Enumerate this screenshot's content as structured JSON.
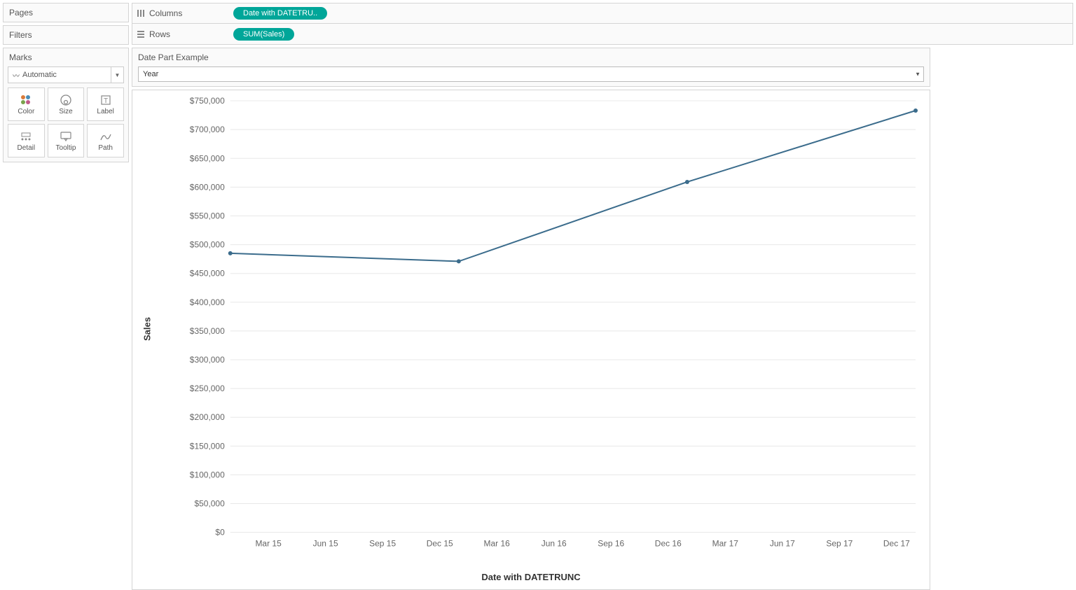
{
  "shelves": {
    "pages_label": "Pages",
    "filters_label": "Filters",
    "marks_label": "Marks",
    "marks_type": "Automatic",
    "mark_buttons": [
      "Color",
      "Size",
      "Label",
      "Detail",
      "Tooltip",
      "Path"
    ],
    "columns_label": "Columns",
    "rows_label": "Rows",
    "columns_pill": "Date with DATETRU..",
    "rows_pill": "SUM(Sales)"
  },
  "axes": {
    "y_label": "Sales",
    "x_label": "Date with DATETRUNC",
    "y_ticks": [
      "$750,000",
      "$700,000",
      "$650,000",
      "$600,000",
      "$550,000",
      "$500,000",
      "$450,000",
      "$400,000",
      "$350,000",
      "$300,000",
      "$250,000",
      "$200,000",
      "$150,000",
      "$100,000",
      "$50,000",
      "$0"
    ],
    "x_ticks": [
      "Mar 15",
      "Jun 15",
      "Sep 15",
      "Dec 15",
      "Mar 16",
      "Jun 16",
      "Sep 16",
      "Dec 16",
      "Mar 17",
      "Jun 17",
      "Sep 17",
      "Dec 17"
    ]
  },
  "parameter": {
    "title": "Date Part Example",
    "value": "Year"
  },
  "chart_data": {
    "type": "line",
    "xlabel": "Date with DATETRUNC",
    "ylabel": "Sales",
    "ylim": [
      0,
      750000
    ],
    "x_categories": [
      "Mar 15",
      "Jun 15",
      "Sep 15",
      "Dec 15",
      "Mar 16",
      "Jun 16",
      "Sep 16",
      "Dec 16",
      "Mar 17",
      "Jun 17",
      "Sep 17",
      "Dec 17"
    ],
    "points": [
      {
        "x": "Jan 15",
        "y": 485000
      },
      {
        "x": "Jan 16",
        "y": 471000
      },
      {
        "x": "Jan 17",
        "y": 609000
      },
      {
        "x": "Jan 18",
        "y": 733000
      }
    ]
  }
}
